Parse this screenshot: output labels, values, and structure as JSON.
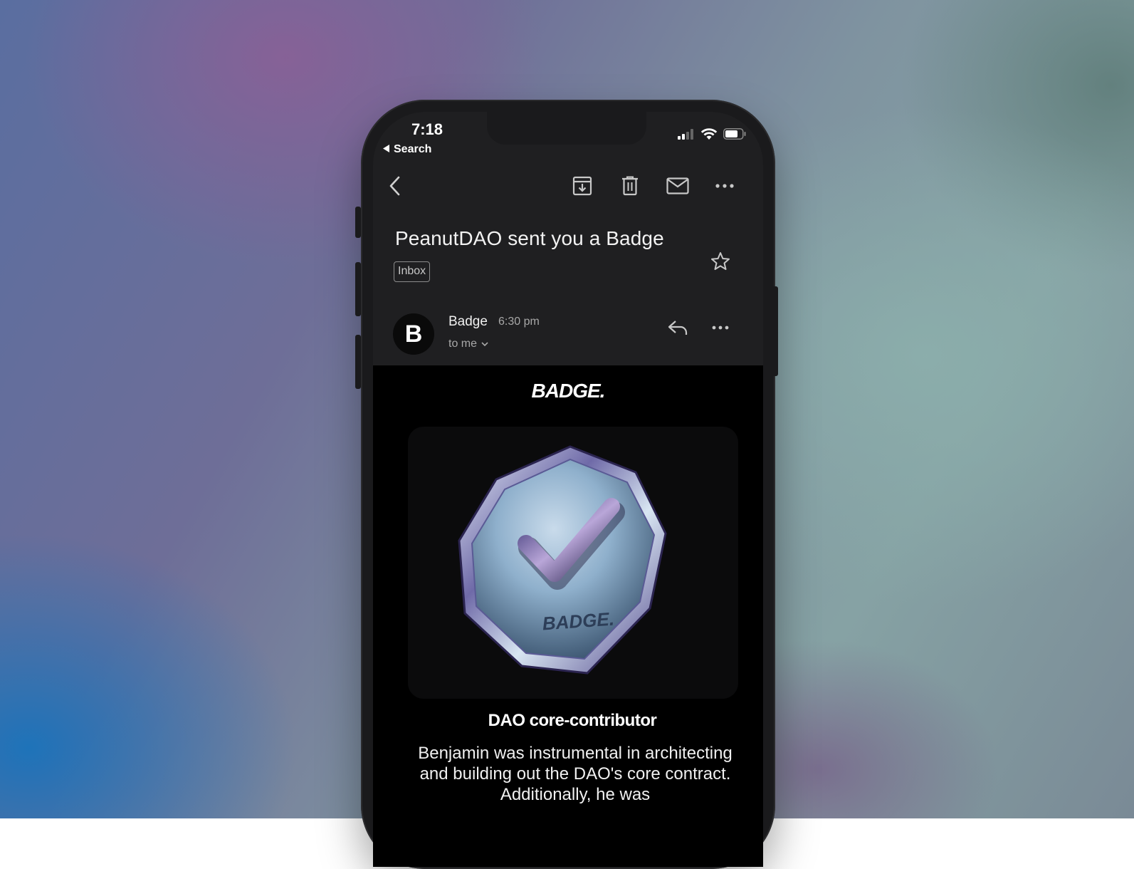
{
  "status_bar": {
    "time": "7:18",
    "back_label": "Search"
  },
  "toolbar": {
    "icons": [
      "back-chevron-icon",
      "archive-icon",
      "trash-icon",
      "mail-icon",
      "more-icon"
    ]
  },
  "email": {
    "subject": "PeanutDAO sent you a Badge",
    "label": "Inbox",
    "sender_initial": "B",
    "sender_name": "Badge",
    "time": "6:30 pm",
    "recipient": "to me"
  },
  "body": {
    "brand": "BADGE.",
    "badge_emblem_text": "BADGE.",
    "badge_title": "DAO core-contributor",
    "badge_description": "Benjamin was instrumental in architecting and building out the DAO's core contract. Additionally, he was"
  },
  "colors": {
    "screen_bg": "#1f1f21",
    "body_bg": "#000000",
    "text_primary": "#f2f2f2",
    "text_secondary": "#a8a8a8"
  }
}
